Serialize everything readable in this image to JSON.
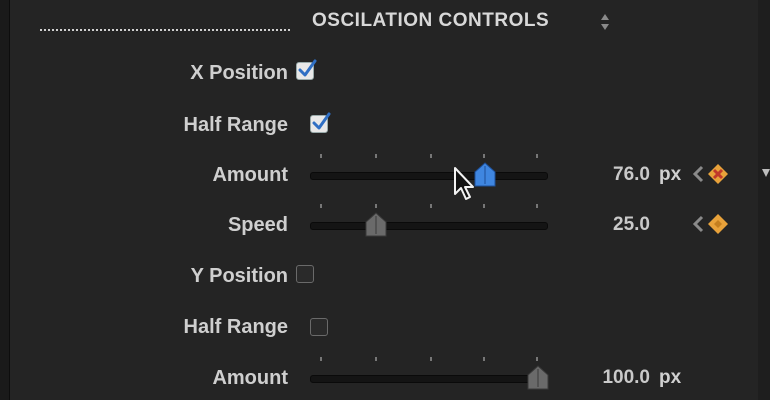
{
  "header": {
    "title": "OSCILATION CONTROLS"
  },
  "rows": {
    "x_position": {
      "label": "X Position",
      "checked": true
    },
    "x_half_range": {
      "label": "Half Range",
      "checked": true
    },
    "x_amount": {
      "label": "Amount",
      "value": "76.0",
      "unit": "px",
      "level": 0.76
    },
    "x_speed": {
      "label": "Speed",
      "value": "25.0",
      "level": 0.25
    },
    "y_position": {
      "label": "Y Position",
      "checked": false
    },
    "y_half_range": {
      "label": "Half Range",
      "checked": false
    },
    "y_amount": {
      "label": "Amount",
      "value": "100.0",
      "unit": "px",
      "level": 1.0
    }
  },
  "colors": {
    "accent_thumb": "#3f86e0",
    "keyframe": "#e8a23a",
    "keyframe_x": "#c0392b"
  },
  "icons": {
    "sort": "up-down-chevron-icon",
    "keyframe": "keyframe-diamond-icon",
    "cursor": "mouse-pointer-icon"
  }
}
